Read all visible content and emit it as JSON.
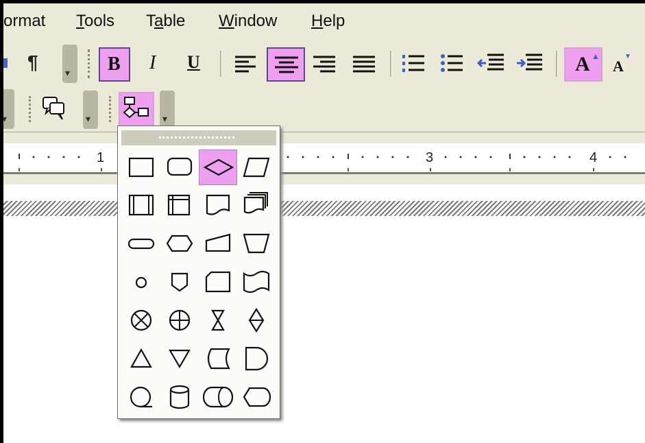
{
  "menubar": {
    "items": [
      {
        "label": "ormat",
        "accel": ""
      },
      {
        "label": "Tools",
        "accel": "T"
      },
      {
        "label": "Table",
        "accel": "a"
      },
      {
        "label": "Window",
        "accel": "W"
      },
      {
        "label": "Help",
        "accel": "H"
      }
    ]
  },
  "formatting_toolbar": {
    "buttons": [
      {
        "name": "show-hide-button",
        "glyph": "¶",
        "active": false
      },
      {
        "name": "bold-button",
        "glyph": "B",
        "active": true
      },
      {
        "name": "italic-button",
        "glyph": "I",
        "active": false
      },
      {
        "name": "underline-button",
        "glyph": "U",
        "active": false
      },
      {
        "name": "align-left-button",
        "glyph": "",
        "active": false
      },
      {
        "name": "align-center-button",
        "glyph": "",
        "active": true
      },
      {
        "name": "align-right-button",
        "glyph": "",
        "active": false
      },
      {
        "name": "justify-button",
        "glyph": "",
        "active": false
      },
      {
        "name": "numbering-button",
        "glyph": "",
        "active": false
      },
      {
        "name": "bullets-button",
        "glyph": "",
        "active": false
      },
      {
        "name": "decrease-indent-button",
        "glyph": "",
        "active": false
      },
      {
        "name": "increase-indent-button",
        "glyph": "",
        "active": false
      },
      {
        "name": "grow-font-button",
        "glyph": "A",
        "active": true
      },
      {
        "name": "shrink-font-button",
        "glyph": "A",
        "active": false
      }
    ]
  },
  "drawing_toolbar": {
    "callouts_icon": "callouts-icon",
    "flowchart_icon": "flowchart-icon",
    "flowchart_active": true
  },
  "ruler": {
    "numbers": [
      "1",
      "3",
      "4"
    ]
  },
  "flowchart_palette": {
    "selected": "decision",
    "shapes": [
      "process",
      "alternate-process",
      "decision",
      "data",
      "predefined-process",
      "internal-storage",
      "document",
      "multidocument",
      "terminator",
      "preparation",
      "manual-input",
      "manual-operation",
      "connector",
      "off-page-connector",
      "card",
      "punched-tape",
      "summing-junction",
      "or",
      "collate",
      "sort",
      "extract",
      "merge",
      "stored-data",
      "delay",
      "sequential-access-storage",
      "magnetic-disk",
      "direct-access-storage",
      "display"
    ]
  },
  "colors": {
    "highlight": "#ee9ff0",
    "chrome": "#ece9d8",
    "border": "#5b4a8a"
  }
}
